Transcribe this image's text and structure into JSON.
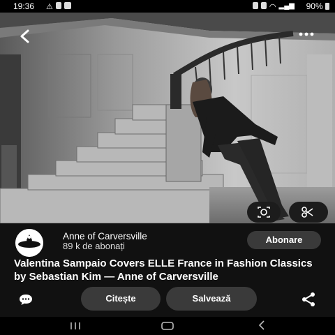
{
  "status_bar": {
    "time": "19:36",
    "battery": "90%"
  },
  "pin": {
    "author": "Anne of Carversville",
    "followers": "89 k de abonați",
    "title": "Valentina Sampaio Covers ELLE France in Fashion Classics by Sebastian Kim — Anne of Carversville"
  },
  "actions": {
    "subscribe": "Abonare",
    "read": "Citește",
    "save": "Salvează"
  },
  "icons": {
    "back": "chevron-left-icon",
    "more": "more-horizontal-icon",
    "lens": "visual-search-icon",
    "crop": "scissors-icon",
    "comment": "comment-icon",
    "share": "share-icon"
  },
  "colors": {
    "button_bg": "#3a3a3a",
    "panel_bg": "#111111"
  }
}
